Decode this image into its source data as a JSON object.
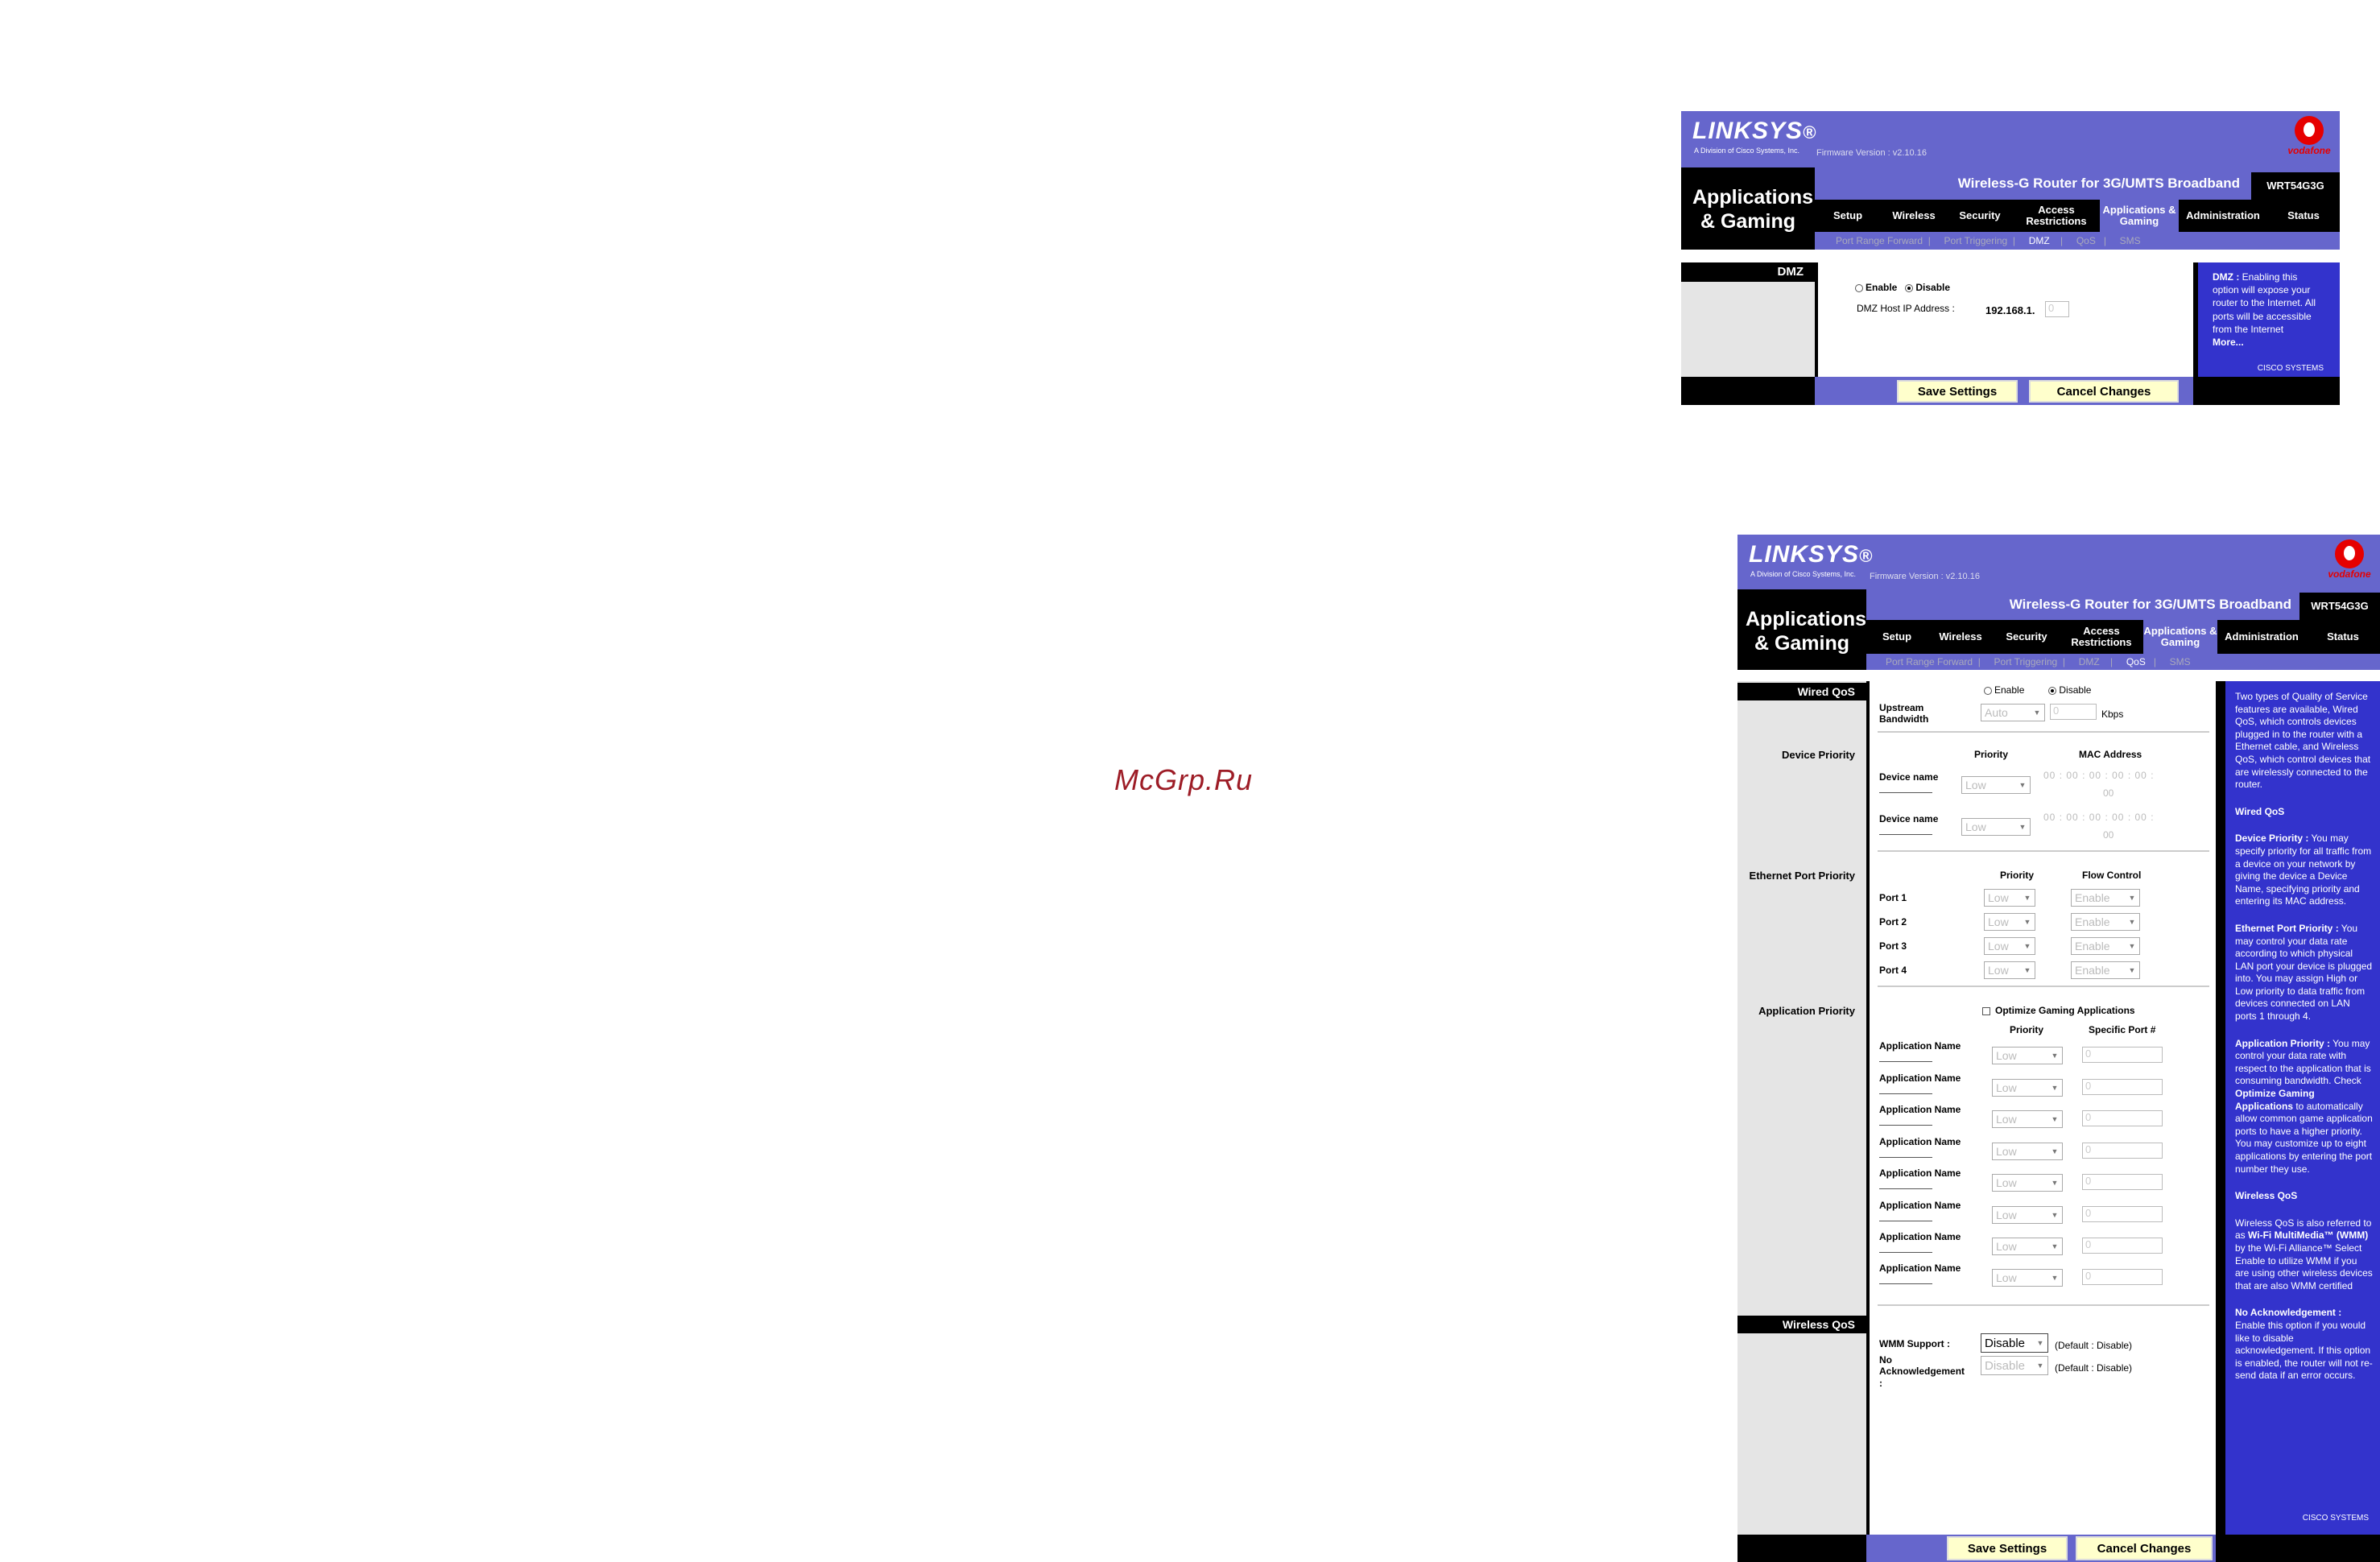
{
  "watermark": "McGrp.Ru",
  "brand": {
    "logo": "LINKSYS",
    "reg": "®",
    "logo_sub": "A Division of Cisco Systems, Inc.",
    "firmware": "Firmware Version : v2.10.16",
    "vodafone": "vodafone",
    "product": "Wireless-G Router for 3G/UMTS Broadband",
    "model": "WRT54G3G",
    "cisco": "CISCO SYSTEMS"
  },
  "page_title": "Applications & Gaming",
  "nav": {
    "setup": "Setup",
    "wireless": "Wireless",
    "security": "Security",
    "access": "Access Restrictions",
    "apps": "Applications & Gaming",
    "admin": "Administration",
    "status": "Status"
  },
  "subnav": {
    "pf": "Port Range Forward",
    "pt": "Port Triggering",
    "dmz": "DMZ",
    "qos": "QoS",
    "sms": "SMS",
    "sep": "|"
  },
  "buttons": {
    "save": "Save Settings",
    "cancel": "Cancel Changes"
  },
  "dmz": {
    "section": "DMZ",
    "enable": "Enable",
    "disable": "Disable",
    "host_label": "DMZ Host IP Address :",
    "ip_prefix": "192.168.1.",
    "ip_last": "0",
    "help_title": "DMZ :",
    "help_body": " Enabling this option will expose your router to the Internet. All ports will be accessible from the Internet",
    "more": "More..."
  },
  "qos": {
    "wired_section": "Wired QoS",
    "enable": "Enable",
    "disable": "Disable",
    "upstream": "Upstream Bandwidth",
    "auto": "Auto",
    "bw_value": "0",
    "kbps": "Kbps",
    "device_section": "Device Priority",
    "priority": "Priority",
    "mac": "MAC Address",
    "device_name": "Device name",
    "low": "Low",
    "mac_octet": "00",
    "eth_section": "Ethernet Port Priority",
    "flow": "Flow Control",
    "ports": [
      "Port 1",
      "Port 2",
      "Port 3",
      "Port 4"
    ],
    "enable_opt": "Enable",
    "app_section": "Application Priority",
    "optimize": "Optimize Gaming Applications",
    "specific_port": "Specific Port #",
    "app_name": "Application Name",
    "port_value": "0",
    "wireless_section": "Wireless QoS",
    "wmm": "WMM Support :",
    "wmm_value": "Disable",
    "default": "(Default : Disable)",
    "noack": "No Acknowledgement :",
    "noack_value": "Disable"
  },
  "help": {
    "intro": "Two types of Quality of Service features are available, Wired QoS, which controls devices plugged in to the router with a Ethernet cable, and Wireless QoS, which control devices that are wirelessly connected to the router.",
    "wired_title": "Wired QoS",
    "device_title": "Device Priority :",
    "device_body": " You may specify priority for all traffic from a device on your network by giving the device a Device Name, specifying priority and entering its MAC address.",
    "eth_title": "Ethernet Port Priority :",
    "eth_body": " You may control your data rate according to which physical LAN port your device is plugged into. You may assign High or Low priority to data traffic from devices connected on LAN ports 1 through 4.",
    "app_title": "Application Priority :",
    "app_body1": " You may control your data rate with respect to the application that is consuming bandwidth. Check ",
    "app_bold": "Optimize Gaming Applications",
    "app_body2": " to automatically allow common game application ports to have a higher priority. You may customize up to eight applications by entering the port number they use.",
    "wireless_title": "Wireless QoS",
    "wl_body1": "Wireless QoS is also referred to as ",
    "wl_bold": "Wi-Fi MultiMedia™ (WMM)",
    "wl_body2": " by the Wi-Fi Alliance™ Select Enable to utilize WMM if you are using other wireless devices that are also WMM certified",
    "noack_title": "No Acknowledgement :",
    "noack_body": " Enable this option if you would like to disable acknowledgement. If this option is enabled, the router will not re-send data if an error occurs."
  }
}
